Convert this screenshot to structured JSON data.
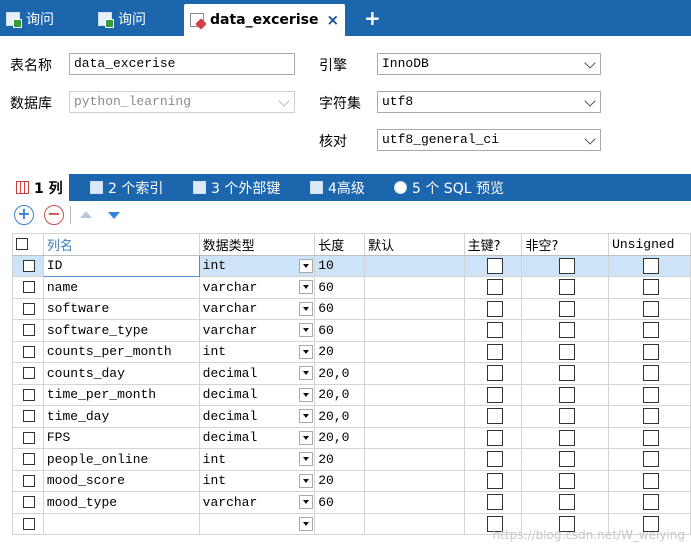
{
  "tabs": [
    {
      "label": "询问"
    },
    {
      "label": "询问"
    },
    {
      "label": "data_excerise",
      "close": "×"
    }
  ],
  "new_tab": "+",
  "form": {
    "table_name_label": "表名称",
    "table_name_value": "data_excerise",
    "database_label": "数据库",
    "database_value": "python_learning",
    "engine_label": "引擎",
    "engine_value": "InnoDB",
    "charset_label": "字符集",
    "charset_value": "utf8",
    "collation_label": "核对",
    "collation_value": "utf8_general_ci"
  },
  "subtabs": [
    {
      "label": "1 列"
    },
    {
      "label": "2 个索引"
    },
    {
      "label": "3 个外部键"
    },
    {
      "label": "4高级"
    },
    {
      "label": "5 个 SQL 预览"
    }
  ],
  "toolbar": {
    "add": "+",
    "remove": "−"
  },
  "grid": {
    "headers": [
      "列名",
      "数据类型",
      "长度",
      "默认",
      "主键?",
      "非空?",
      "Unsigned"
    ],
    "rows": [
      {
        "name": "ID",
        "type": "int",
        "length": "10"
      },
      {
        "name": "name",
        "type": "varchar",
        "length": "60"
      },
      {
        "name": "software",
        "type": "varchar",
        "length": "60"
      },
      {
        "name": "software_type",
        "type": "varchar",
        "length": "60"
      },
      {
        "name": "counts_per_month",
        "type": "int",
        "length": "20"
      },
      {
        "name": "counts_day",
        "type": "decimal",
        "length": "20,0"
      },
      {
        "name": "time_per_month",
        "type": "decimal",
        "length": "20,0"
      },
      {
        "name": "time_day",
        "type": "decimal",
        "length": "20,0"
      },
      {
        "name": "FPS",
        "type": "decimal",
        "length": "20,0"
      },
      {
        "name": "people_online",
        "type": "int",
        "length": "20"
      },
      {
        "name": "mood_score",
        "type": "int",
        "length": "20"
      },
      {
        "name": "mood_type",
        "type": "varchar",
        "length": "60"
      },
      {
        "name": "",
        "type": "",
        "length": ""
      }
    ]
  },
  "watermark": "https://blog.csdn.net/W_weiying",
  "colors": {
    "accent": "#1c66ae",
    "selected_row": "#cde3f7"
  }
}
